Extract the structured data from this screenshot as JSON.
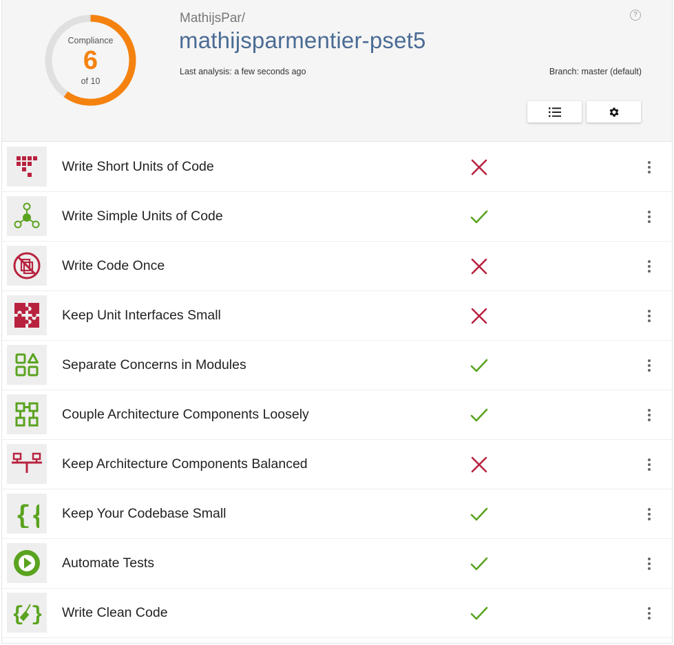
{
  "colors": {
    "fail": "#b8223f",
    "pass": "#5aa31f",
    "gauge": "#f5820f",
    "gauge_track": "#e0e0e0",
    "repo": "#4a6b94"
  },
  "gauge": {
    "label": "Compliance",
    "score": "6",
    "of": "of 10",
    "fraction": 0.6
  },
  "header": {
    "owner": "MathijsPar/",
    "repo": "mathijsparmentier-pset5",
    "last_analysis": "Last analysis: a few seconds ago",
    "branch": "Branch: master (default)",
    "help_glyph": "?"
  },
  "toolbar": {
    "list_icon": "list-icon",
    "settings_icon": "gear-icon"
  },
  "guidelines": [
    {
      "label": "Write Short Units of Code",
      "status": "fail",
      "icon": "short-units-icon"
    },
    {
      "label": "Write Simple Units of Code",
      "status": "pass",
      "icon": "simple-units-icon"
    },
    {
      "label": "Write Code Once",
      "status": "fail",
      "icon": "no-duplication-icon"
    },
    {
      "label": "Keep Unit Interfaces Small",
      "status": "fail",
      "icon": "puzzle-icon"
    },
    {
      "label": "Separate Concerns in Modules",
      "status": "pass",
      "icon": "modules-icon"
    },
    {
      "label": "Couple Architecture Components Loosely",
      "status": "pass",
      "icon": "components-icon"
    },
    {
      "label": "Keep Architecture Components Balanced",
      "status": "fail",
      "icon": "balance-icon"
    },
    {
      "label": "Keep Your Codebase Small",
      "status": "pass",
      "icon": "braces-icon"
    },
    {
      "label": "Automate Tests",
      "status": "pass",
      "icon": "play-icon"
    },
    {
      "label": "Write Clean Code",
      "status": "pass",
      "icon": "broom-braces-icon"
    }
  ]
}
